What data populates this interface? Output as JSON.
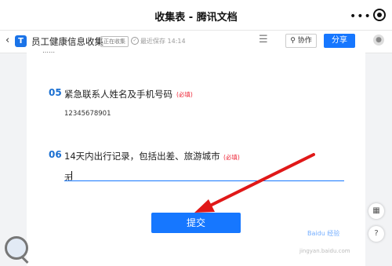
{
  "window": {
    "title": "收集表 - 腾讯文档"
  },
  "toolbar": {
    "back_icon": "‹",
    "logo_icon": "T",
    "doc_name": "员工健康信息收集",
    "status_badge": "正在收集",
    "saved_icon": "✓",
    "saved_text": "最近保存 14:14",
    "menu_icon": "☰",
    "collab_label": "协作",
    "share_label": "分享"
  },
  "form": {
    "questions": [
      {
        "number": "05",
        "text": "紧急联系人姓名及手机号码",
        "required": "(必填)",
        "answer": "12345678901"
      },
      {
        "number": "06",
        "text": "14天内出行记录，包括出差、旅游城市",
        "required": "(必填)",
        "answer": "无"
      }
    ],
    "submit_label": "提交"
  },
  "colors": {
    "accent": "#1677ff",
    "required": "#e23333",
    "arrow": "#e01818"
  }
}
